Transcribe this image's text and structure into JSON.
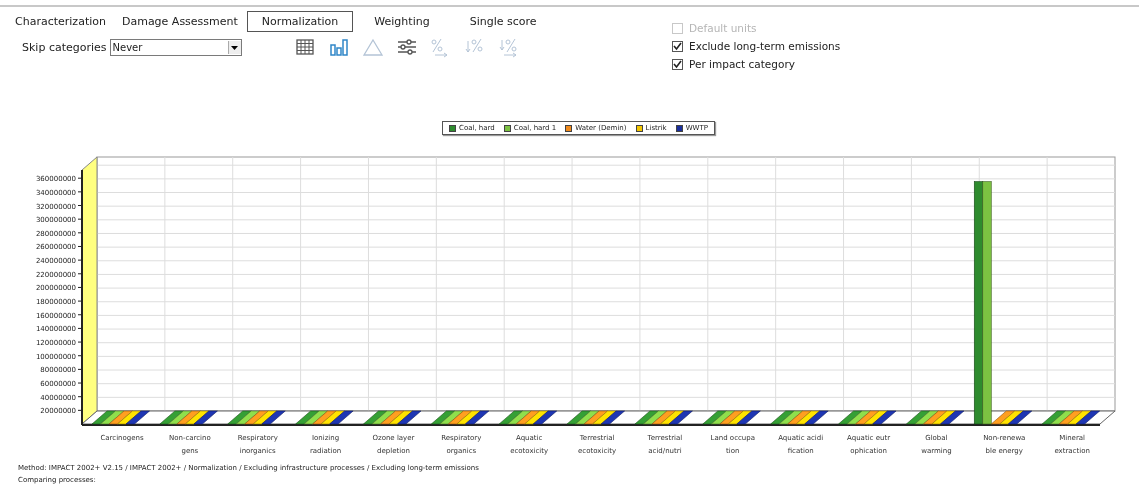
{
  "tabs": [
    {
      "label": "Characterization",
      "selected": false
    },
    {
      "label": "Damage Assessment",
      "selected": false
    },
    {
      "label": "Normalization",
      "selected": true
    },
    {
      "label": "Weighting",
      "selected": false
    },
    {
      "label": "Single score",
      "selected": false
    }
  ],
  "skip_categories": {
    "label": "Skip categories",
    "value": "Never"
  },
  "toolbar": [
    {
      "kind": "table",
      "selected": false,
      "disabled": false
    },
    {
      "kind": "bars",
      "selected": true,
      "disabled": false
    },
    {
      "kind": "triangle",
      "selected": false,
      "disabled": true
    },
    {
      "kind": "sliders",
      "selected": false,
      "disabled": false
    },
    {
      "kind": "percent",
      "selected": false,
      "disabled": true
    },
    {
      "kind": "sort-percent",
      "selected": false,
      "disabled": true
    },
    {
      "kind": "sort-percent-arrow",
      "selected": false,
      "disabled": true
    }
  ],
  "options": [
    {
      "label": "Default units",
      "checked": false,
      "disabled": true
    },
    {
      "label": "Exclude long-term emissions",
      "checked": true,
      "disabled": false
    },
    {
      "label": "Per impact category",
      "checked": true,
      "disabled": false
    }
  ],
  "chart": {
    "chart_data": {
      "type": "bar",
      "grid": true,
      "categories": [
        "Carcinogens",
        "Non-carcino\ngens",
        "Respiratory\ninorganics",
        "Ionizing\nradiation",
        "Ozone layer\ndepletion",
        "Respiratory\norganics",
        "Aquatic\necotoxicity",
        "Terrestrial\necotoxicity",
        "Terrestrial\nacid/nutri",
        "Land occupa\ntion",
        "Aquatic acidi\nfication",
        "Aquatic eutr\nophication",
        "Global\nwarming",
        "Non-renewa\nble energy",
        "Mineral\nextraction"
      ],
      "series": [
        {
          "name": "Coal, hard",
          "color": "#2e8b2e",
          "values": [
            0,
            0,
            0,
            0,
            0,
            0,
            0,
            0,
            0,
            0,
            0,
            0,
            0,
            355000000,
            0
          ]
        },
        {
          "name": "Coal, hard 1",
          "color": "#7cc242",
          "values": [
            0,
            0,
            0,
            0,
            0,
            0,
            0,
            0,
            0,
            0,
            0,
            0,
            0,
            355000000,
            0
          ]
        },
        {
          "name": "Water (Demin)",
          "color": "#f08a1c",
          "values": [
            0,
            0,
            0,
            0,
            0,
            0,
            0,
            0,
            0,
            0,
            0,
            0,
            0,
            0,
            0
          ]
        },
        {
          "name": "Listrik",
          "color": "#f2c500",
          "values": [
            0,
            0,
            0,
            0,
            0,
            0,
            0,
            0,
            0,
            0,
            0,
            0,
            0,
            0,
            0
          ]
        },
        {
          "name": "WWTP",
          "color": "#1a2f9c",
          "values": [
            0,
            0,
            0,
            0,
            0,
            0,
            0,
            0,
            0,
            0,
            0,
            0,
            0,
            0,
            0
          ]
        }
      ],
      "ylim": [
        0,
        372000000
      ],
      "yticks": [
        20000000,
        40000000,
        60000000,
        80000000,
        100000000,
        120000000,
        140000000,
        160000000,
        180000000,
        200000000,
        220000000,
        240000000,
        260000000,
        280000000,
        300000000,
        320000000,
        340000000,
        360000000
      ]
    }
  },
  "footer": {
    "method": "Method: IMPACT 2002+ V2.15 / IMPACT 2002+ / Normalization / Excluding infrastructure processes / Excluding long-term emissions",
    "comparing": "Comparing processes:"
  }
}
